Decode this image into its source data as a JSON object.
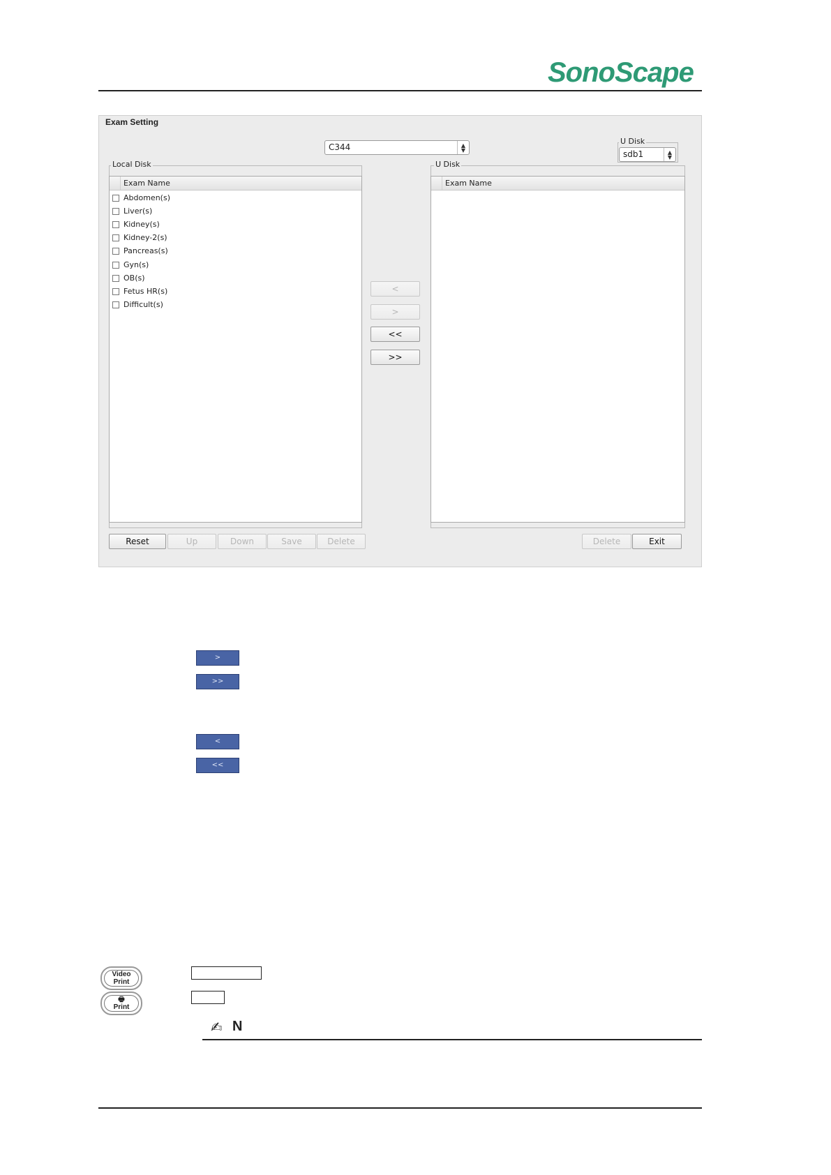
{
  "header": {
    "logo_text": "SonoScape"
  },
  "dialog": {
    "title": "Exam Setting",
    "probe_select": {
      "value": "C344"
    },
    "udisk_select": {
      "label": "U Disk",
      "value": "sdb1"
    },
    "local_disk": {
      "label": "Local Disk",
      "column_header": "Exam Name",
      "items": [
        "Abdomen(s)",
        "Liver(s)",
        "Kidney(s)",
        "Kidney-2(s)",
        "Pancreas(s)",
        "Gyn(s)",
        "OB(s)",
        "Fetus HR(s)",
        "Difficult(s)"
      ]
    },
    "u_disk": {
      "label": "U Disk",
      "column_header": "Exam Name"
    },
    "transfer_buttons": {
      "move_left": "<",
      "move_right": ">",
      "move_all_left": "<<",
      "move_all_right": ">>"
    },
    "bottom_left_buttons": {
      "reset": "Reset",
      "up": "Up",
      "down": "Down",
      "save": "Save",
      "delete": "Delete"
    },
    "bottom_right_buttons": {
      "delete": "Delete",
      "exit": "Exit"
    }
  },
  "doc_buttons": {
    "right": ">",
    "all_right": ">>",
    "left": "<",
    "all_left": "<<"
  },
  "keys": {
    "video_print": {
      "line1": "Video",
      "line2": "Print"
    },
    "print": {
      "line1": "Print"
    }
  },
  "note": {
    "letter": "N"
  },
  "colors": {
    "brand": "#2e9a75",
    "blue_button": "#4964a5",
    "dialog_bg": "#ececec"
  }
}
